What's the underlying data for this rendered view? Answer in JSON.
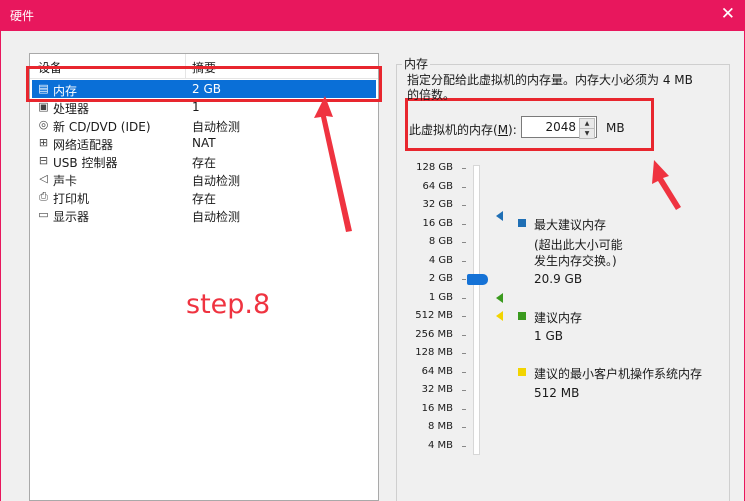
{
  "window": {
    "title": "硬件",
    "close_glyph": "✕"
  },
  "device_list": {
    "header": {
      "device": "设备",
      "summary": "摘要"
    },
    "rows": [
      {
        "icon": "memory-icon",
        "name": "内存",
        "summary": "2 GB",
        "selected": true
      },
      {
        "icon": "processor-icon",
        "name": "处理器",
        "summary": "1",
        "selected": false
      },
      {
        "icon": "cd-dvd-icon",
        "name": "新 CD/DVD (IDE)",
        "summary": "自动检测",
        "selected": false
      },
      {
        "icon": "network-adapter-icon",
        "name": "网络适配器",
        "summary": "NAT",
        "selected": false
      },
      {
        "icon": "usb-icon",
        "name": "USB 控制器",
        "summary": "存在",
        "selected": false
      },
      {
        "icon": "sound-card-icon",
        "name": "声卡",
        "summary": "自动检测",
        "selected": false
      },
      {
        "icon": "printer-icon",
        "name": "打印机",
        "summary": "存在",
        "selected": false
      },
      {
        "icon": "display-icon",
        "name": "显示器",
        "summary": "自动检测",
        "selected": false
      }
    ]
  },
  "memory_panel": {
    "group_label": "内存",
    "description": "指定分配给此虚拟机的内存量。内存大小必须为 4 MB 的倍数。",
    "field_label_prefix": "此虚拟机的内存(",
    "field_label_key": "M",
    "field_label_suffix": "):",
    "value": "2048",
    "unit": "MB",
    "scale_labels": [
      "128 GB",
      "64 GB",
      "32 GB",
      "16 GB",
      "8 GB",
      "4 GB",
      "2 GB",
      "1 GB",
      "512 MB",
      "256 MB",
      "128 MB",
      "64 MB",
      "32 MB",
      "16 MB",
      "8 MB",
      "4 MB"
    ],
    "slider_value": "2 GB",
    "legend": {
      "max": {
        "label": "最大建议内存",
        "note_line1": "(超出此大小可能",
        "note_line2": "发生内存交换。)",
        "value": "20.9 GB",
        "color": "#1f6fb5"
      },
      "recommended": {
        "label": "建议内存",
        "value": "1 GB",
        "color": "#3a9a1e"
      },
      "min": {
        "label": "建议的最小客户机操作系统内存",
        "value": "512 MB",
        "color": "#f2d400"
      }
    }
  },
  "annotation": {
    "text": "step.8",
    "color": "#ef3340"
  }
}
